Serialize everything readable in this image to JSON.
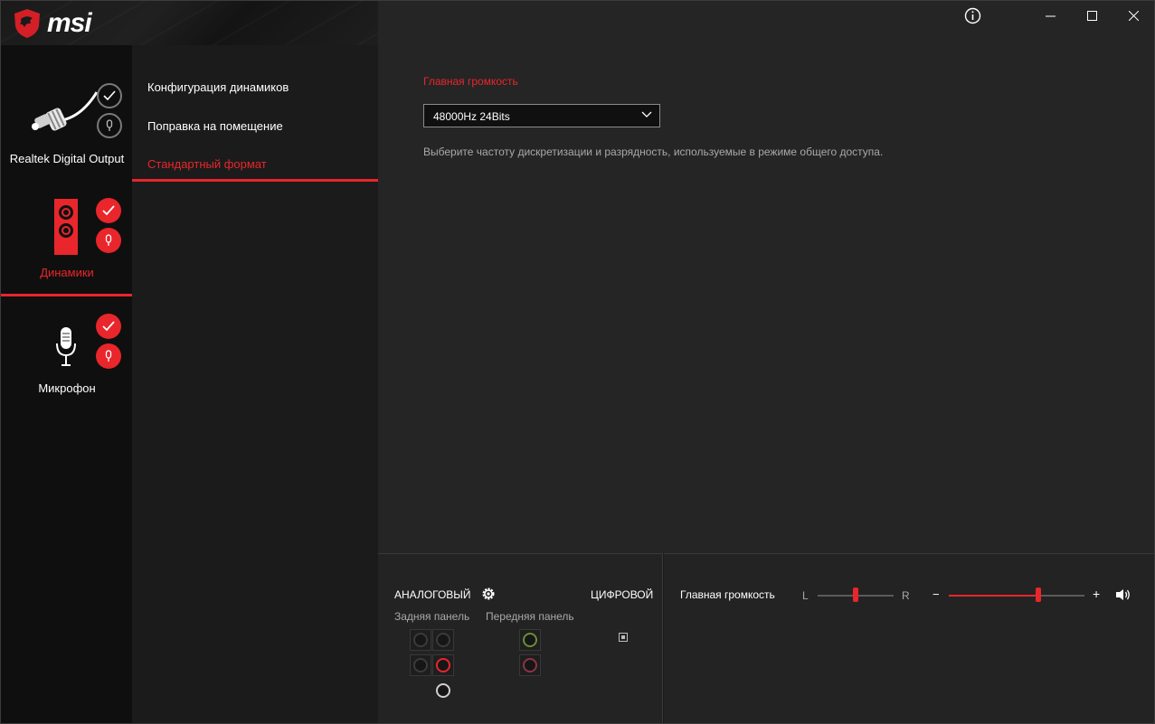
{
  "brand": {
    "name": "msi"
  },
  "devices": [
    {
      "label": "Realtek Digital Output",
      "icon": "digital-cable-icon",
      "active": false
    },
    {
      "label": "Динамики",
      "icon": "speaker-icon",
      "active": true
    },
    {
      "label": "Микрофон",
      "icon": "microphone-icon",
      "active": false
    }
  ],
  "menu": {
    "items": [
      "Конфигурация динамиков",
      "Поправка на помещение",
      "Стандартный формат"
    ],
    "active_index": 2
  },
  "main": {
    "section_title": "Главная громкость",
    "format_value": "48000Hz 24Bits",
    "description": "Выберите частоту дискретизации и разрядность, используемые в режиме общего доступа."
  },
  "jacks": {
    "analog_label": "АНАЛОГОВЫЙ",
    "digital_label": "ЦИФРОВОЙ",
    "rear_label": "Задняя панель",
    "front_label": "Передняя панель"
  },
  "volume": {
    "label": "Главная громкость",
    "left_label": "L",
    "right_label": "R",
    "minus": "−",
    "plus": "+",
    "balance": 0.5,
    "level": 0.66
  },
  "colors": {
    "accent": "#e8262b",
    "background": "#252525",
    "sidebar": "#0f0f0f"
  }
}
